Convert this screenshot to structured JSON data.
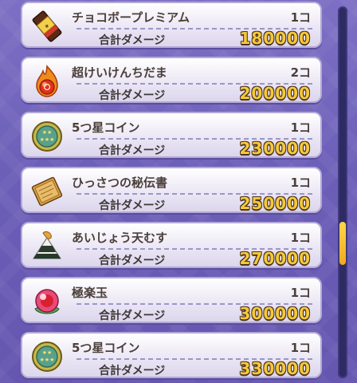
{
  "items": [
    {
      "name": "チョコボープレミアム",
      "qty": "1コ",
      "damage_label": "合計ダメージ",
      "damage": "180000",
      "icon": "chocolate-bar-icon"
    },
    {
      "name": "超けいけんちだま",
      "qty": "2コ",
      "damage_label": "合計ダメージ",
      "damage": "200000",
      "icon": "fire-orb-icon"
    },
    {
      "name": "5つ星コイン",
      "qty": "1コ",
      "damage_label": "合計ダメージ",
      "damage": "230000",
      "icon": "star-coin-icon"
    },
    {
      "name": "ひっさつの秘伝書",
      "qty": "1コ",
      "damage_label": "合計ダメージ",
      "damage": "250000",
      "icon": "scroll-book-icon"
    },
    {
      "name": "あいじょう天むす",
      "qty": "1コ",
      "damage_label": "合計ダメージ",
      "damage": "270000",
      "icon": "tenmusu-riceball-icon"
    },
    {
      "name": "極楽玉",
      "qty": "1コ",
      "damage_label": "合計ダメージ",
      "damage": "300000",
      "icon": "pink-orb-icon"
    },
    {
      "name": "5つ星コイン",
      "qty": "1コ",
      "damage_label": "合計ダメージ",
      "damage": "330000",
      "icon": "star-coin-icon"
    }
  ],
  "colors": {
    "damage_value": "#f6c93a",
    "scroll_thumb": "#f2a91f",
    "background": "#6c5fb8"
  },
  "scroll": {
    "position_fraction": 0.62
  }
}
